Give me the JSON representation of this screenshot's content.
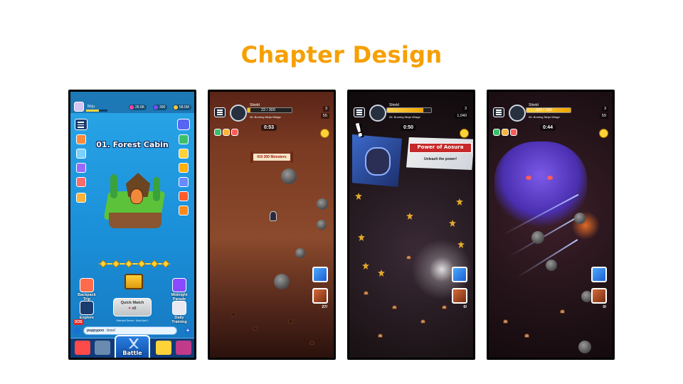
{
  "page": {
    "title": "Chapter Design"
  },
  "lobby": {
    "player_name": "Ni:ju",
    "currencies": [
      {
        "value": "26.6K",
        "color": "#ff3fa0"
      },
      {
        "value": "300",
        "color": "#7a4dff"
      },
      {
        "value": "58.5M",
        "color": "#ffc93a"
      }
    ],
    "chapter_title": "01. Forest Cabin",
    "buttons": {
      "backpack_trip": "Backpack Trip",
      "midnight_parade": "Midnight Parade",
      "explore": "Explore",
      "daily_training": "Daily Training",
      "quick_match": "Quick Match",
      "quick_match_cost": "x5"
    },
    "server_text": "Selected Server : Asia-East 1",
    "sos_label": "SOS",
    "chat": {
      "user": "puppypoo",
      "message": "boss!"
    },
    "nav": {
      "battle": "Battle"
    }
  },
  "run1": {
    "hud_name": "Shield",
    "hud_progress": "22 / 300",
    "hud_subtitle": "06. Burning Ninja Village",
    "hud_stat_1": "3",
    "hud_stat_2": "55",
    "timer": "0:53",
    "banner": "Kill 300 Monsters",
    "skill_count": "27/"
  },
  "run2": {
    "hud_name": "Shield",
    "hud_subtitle": "06. Burning Ninja Village",
    "hud_stat_1": "3",
    "hud_stat_2": "1,040",
    "timer": "0:50",
    "popup_title": "Power of Aosura",
    "popup_subtitle": "Unleash the power!",
    "exclaim": "!",
    "skill_count": "0/"
  },
  "run3": {
    "hud_name": "Shield",
    "hud_progress": "300 / 300",
    "hud_subtitle": "06. Burning Ninja Village",
    "hud_stat_1": "3",
    "hud_stat_2": "59",
    "timer": "0:44",
    "skill_count": "0/"
  }
}
